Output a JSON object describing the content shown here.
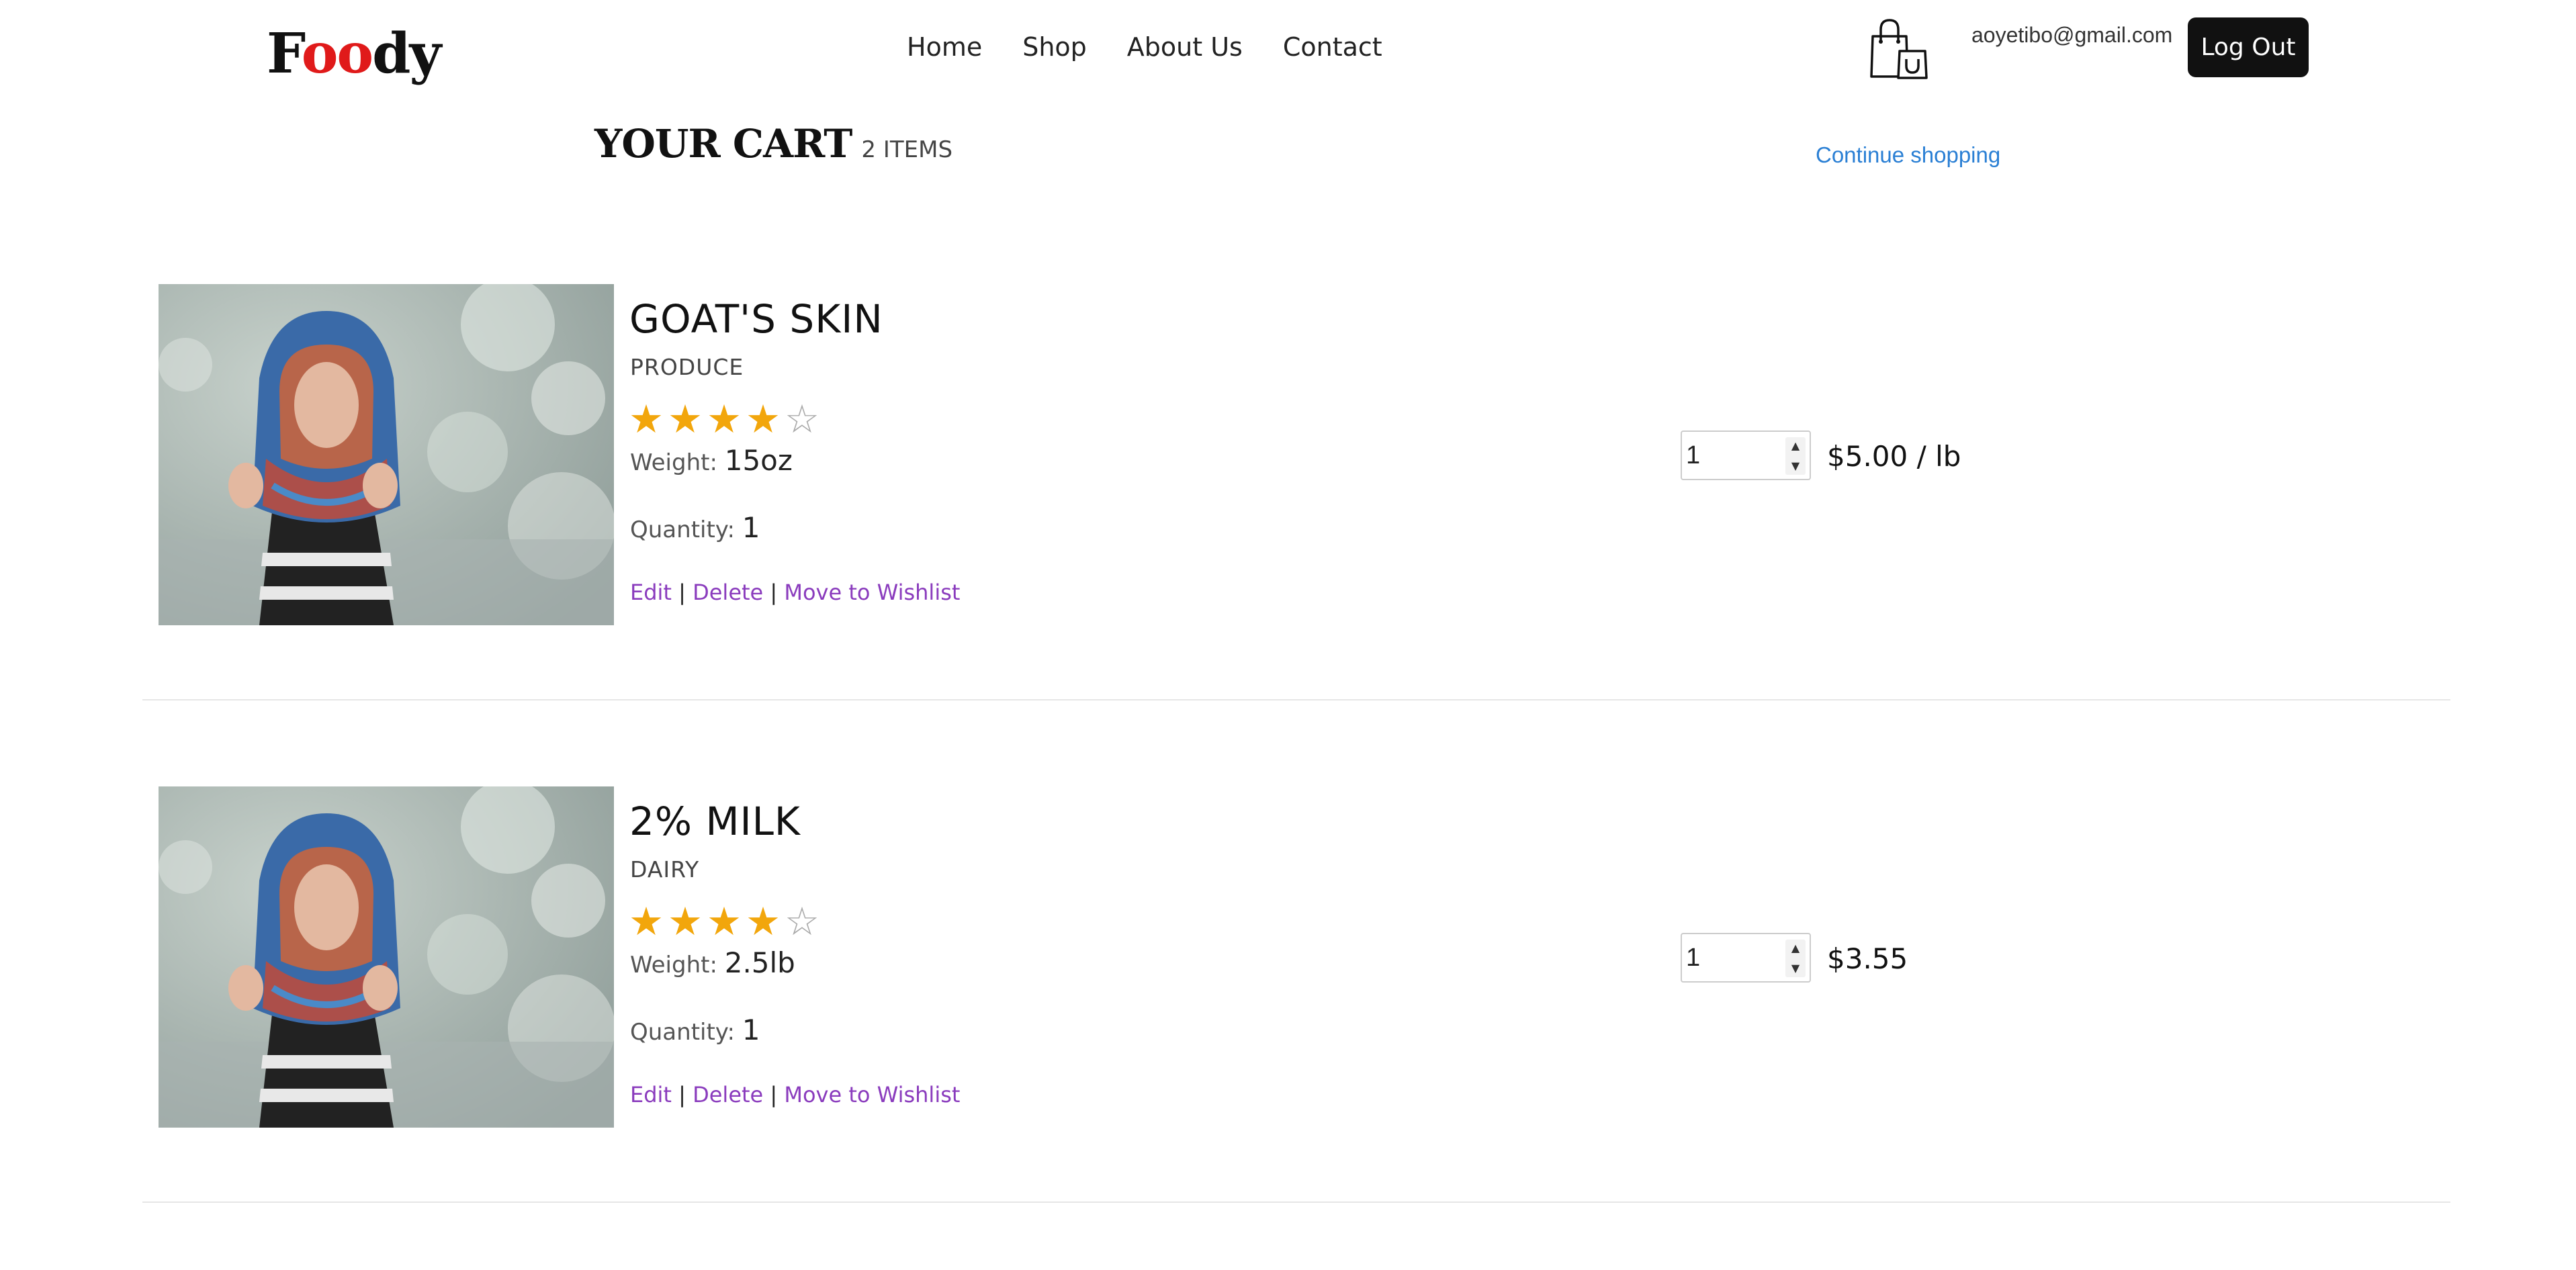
{
  "header": {
    "logo": {
      "f": "F",
      "oo": "oo",
      "dy": "dy"
    },
    "nav": [
      "Home",
      "Shop",
      "About Us",
      "Contact"
    ],
    "user_email": "aoyetibo@gmail.com",
    "logout_label": "Log Out",
    "cart_icon": "shopping-bag-icon"
  },
  "cart": {
    "title": "YOUR CART",
    "count_label": "2 ITEMS",
    "continue_label": "Continue shopping",
    "items": [
      {
        "name": "GOAT'S SKIN",
        "category": "PRODUCE",
        "rating": 4,
        "rating_max": 5,
        "weight_label": "Weight",
        "weight": "15oz",
        "quantity_label": "Quantity:",
        "quantity": "1",
        "stepper_value": "1",
        "price": "$5.00 / lb",
        "actions": {
          "edit": "Edit",
          "delete": "Delete",
          "wishlist": "Move to Wishlist",
          "sep": "|"
        }
      },
      {
        "name": "2% MILK",
        "category": "DAIRY",
        "rating": 4,
        "rating_max": 5,
        "weight_label": "Weight",
        "weight": "2.5lb",
        "quantity_label": "Quantity:",
        "quantity": "1",
        "stepper_value": "1",
        "price": "$3.55",
        "actions": {
          "edit": "Edit",
          "delete": "Delete",
          "wishlist": "Move to Wishlist",
          "sep": "|"
        }
      }
    ]
  },
  "colors": {
    "logo_accent": "#e01a1a",
    "star": "#f2a60c",
    "link_purple": "#8a3bbd",
    "link_blue": "#2a7fd4",
    "button_dark": "#111111"
  }
}
